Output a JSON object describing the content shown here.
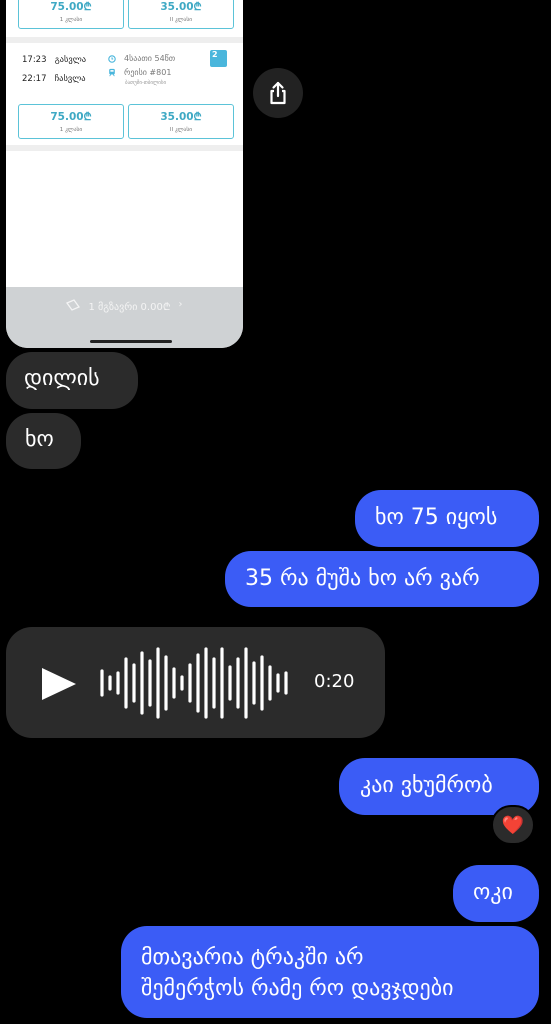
{
  "shared_screenshot": {
    "top_prices": [
      {
        "amount": "75.00₾",
        "sub": "1 კლასი"
      },
      {
        "amount": "35.00₾",
        "sub": "II კლასი"
      }
    ],
    "trip": {
      "depart_time": "17:23",
      "depart_label": "გასვლა",
      "arrive_time": "22:17",
      "arrive_label": "ჩასვლა",
      "duration": "4საათი 54წთ",
      "train": "რეისი #801",
      "route": "ბათუმი-თბილისი",
      "badge": "2"
    },
    "bottom_prices": [
      {
        "amount": "75.00₾",
        "sub": "1 კლასი"
      },
      {
        "amount": "35.00₾",
        "sub": "II კლასი"
      }
    ],
    "footer": "1 მგზავრი 0.00₾"
  },
  "messages": {
    "in_1": "დილის",
    "in_2": "ხო",
    "out_1": "ხო 75 იყოს",
    "out_2": "35 რა მუშა ხო არ ვარ",
    "voice_duration": "0:20",
    "out_3": "კაი ვხუმრობ",
    "reaction": "❤️",
    "out_4": "ოკი",
    "out_5_line1": "მთავარია ტრაკში არ",
    "out_5_line2": "შემერჭოს რამე რო დავჯდები"
  },
  "colors": {
    "outgoing_bubble": "#3b5cf6",
    "incoming_bubble": "#2b2b2b",
    "price_accent": "#3fa9c4"
  },
  "icons": {
    "share": "share-icon",
    "play": "play-icon",
    "clock": "clock-icon",
    "train": "train-icon"
  }
}
